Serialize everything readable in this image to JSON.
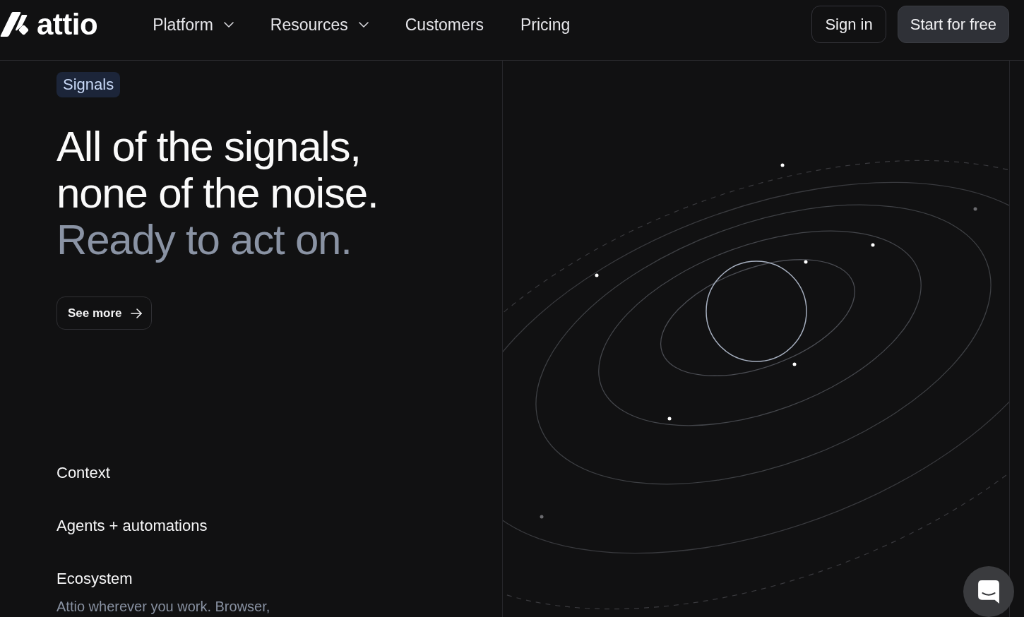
{
  "header": {
    "logo": {
      "text": "attio"
    },
    "nav": [
      {
        "label": "Platform",
        "dropdown": true
      },
      {
        "label": "Resources",
        "dropdown": true
      },
      {
        "label": "Customers",
        "dropdown": false
      },
      {
        "label": "Pricing",
        "dropdown": false
      }
    ],
    "actions": [
      {
        "label": "Sign in",
        "kind": "secondary"
      },
      {
        "label": "Start for free",
        "kind": "primary"
      }
    ]
  },
  "hero": {
    "badge": "Signals",
    "heading": [
      {
        "text": "All of the signals,",
        "muted": false
      },
      {
        "text": "none of the noise.",
        "muted": false
      },
      {
        "text": "Ready to act on.",
        "muted": true
      }
    ],
    "button": {
      "label": "See more"
    }
  },
  "features": [
    {
      "title": "Context"
    },
    {
      "title": "Agents + automations"
    },
    {
      "title": "Ecosystem",
      "description": "Attio wherever you work. Browser,"
    }
  ]
}
